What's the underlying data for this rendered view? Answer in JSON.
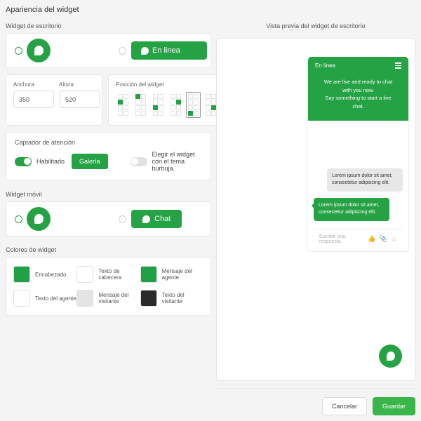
{
  "page": {
    "title": "Apariencia del widget"
  },
  "desktop": {
    "label": "Widget de escritorio",
    "option_bubble_selected": true,
    "online_pill_label": "En linea",
    "size": {
      "width_label": "Anchura",
      "height_label": "Altura",
      "width_value": "350",
      "height_value": "520"
    },
    "position": {
      "label": "Posición del widget",
      "selected_index": 4,
      "options": [
        {
          "name": "left-middle",
          "rows": 4,
          "cols": 2,
          "on": [
            2
          ]
        },
        {
          "name": "left-top",
          "rows": 4,
          "cols": 2,
          "on": [
            0
          ]
        },
        {
          "name": "left-lower",
          "rows": 4,
          "cols": 2,
          "on": [
            4
          ]
        },
        {
          "name": "right-upper",
          "rows": 4,
          "cols": 2,
          "on": [
            3
          ]
        },
        {
          "name": "left-bottom",
          "rows": 4,
          "cols": 2,
          "on": [
            6
          ]
        },
        {
          "name": "right-lower",
          "rows": 4,
          "cols": 2,
          "on": [
            5
          ]
        }
      ]
    }
  },
  "attention_grabber": {
    "title": "Captador de atención",
    "enabled_label": "Habilitado",
    "enabled": true,
    "gallery_button": "Galería",
    "bubble_theme_label": "Elegir el widget con el tema burbuja.",
    "bubble_theme_enabled": false
  },
  "mobile": {
    "label": "Widget móvil",
    "option_bubble_selected": true,
    "chat_pill_label": "Chat"
  },
  "colors": {
    "label": "Colores de widget",
    "items": [
      {
        "name": "Encabezado",
        "hex": "#22a046"
      },
      {
        "name": "Texto de cabecera",
        "hex": "#ffffff"
      },
      {
        "name": "Mensaje del agente",
        "hex": "#22a046"
      },
      {
        "name": "Texto del agente",
        "hex": "#ffffff"
      },
      {
        "name": "Mensaje del visitante",
        "hex": "#e4e4e4"
      },
      {
        "name": "Texto del visitante",
        "hex": "#2b2b2b"
      }
    ]
  },
  "preview": {
    "title": "Vista previa del widget de escritorio",
    "widget": {
      "status": "En linea",
      "menu_icon": "hamburger-icon",
      "greeting_line1": "We are live and ready to chat with you now.",
      "greeting_line2": "Say something to start a live chat.",
      "messages": [
        {
          "role": "visitor",
          "text": "Lorem ipsum dolor sit amet, consectetur adipiscing elit."
        },
        {
          "role": "agent",
          "text": "Lorem ipsum dolor sit amet, consectetur adipiscing elit."
        }
      ],
      "input_placeholder": "Escribir una respuesta.",
      "input_icons": [
        "thumbs-up-icon",
        "paperclip-icon",
        "emoji-icon"
      ]
    },
    "launcher_icon": "chat-bubble-icon"
  },
  "footer": {
    "cancel_label": "Cancelar",
    "save_label": "Guardar"
  },
  "theme": {
    "accent": "#25a244",
    "accent_button": "#3ab54a"
  }
}
